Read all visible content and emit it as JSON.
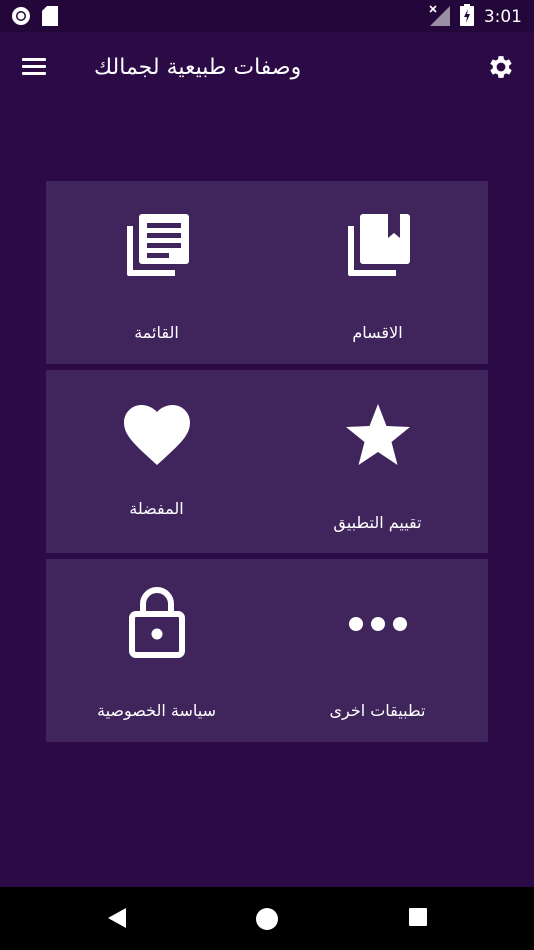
{
  "status_bar": {
    "time": "3:01",
    "left_icons": [
      "circle-notification-icon",
      "sd-card-icon"
    ],
    "right_icons": [
      "signal-off-icon",
      "battery-charging-icon"
    ]
  },
  "app_bar": {
    "title": "وصفات طبيعية لجمالك",
    "menu_icon": "hamburger-menu-icon",
    "settings_icon": "gear-icon"
  },
  "tiles": [
    {
      "id": "categories",
      "label": "الاقسام",
      "icon": "bookmark-library-icon"
    },
    {
      "id": "list",
      "label": "القائمة",
      "icon": "list-library-icon"
    },
    {
      "id": "rate-app",
      "label": "تقييم التطبيق",
      "icon": "star-icon"
    },
    {
      "id": "favorites",
      "label": "المفضلة",
      "icon": "heart-icon"
    },
    {
      "id": "other-apps",
      "label": "تطبيقات اخرى",
      "icon": "more-dots-icon"
    },
    {
      "id": "privacy-policy",
      "label": "سياسة الخصوصية",
      "icon": "lock-icon"
    }
  ],
  "nav_bar": {
    "back_icon": "back-triangle-icon",
    "home_icon": "home-circle-icon",
    "recents_icon": "recents-square-icon"
  },
  "colors": {
    "background": "#2c0a45",
    "status_bar": "#23073a",
    "tile": "#40255c",
    "text": "#ffffff"
  }
}
